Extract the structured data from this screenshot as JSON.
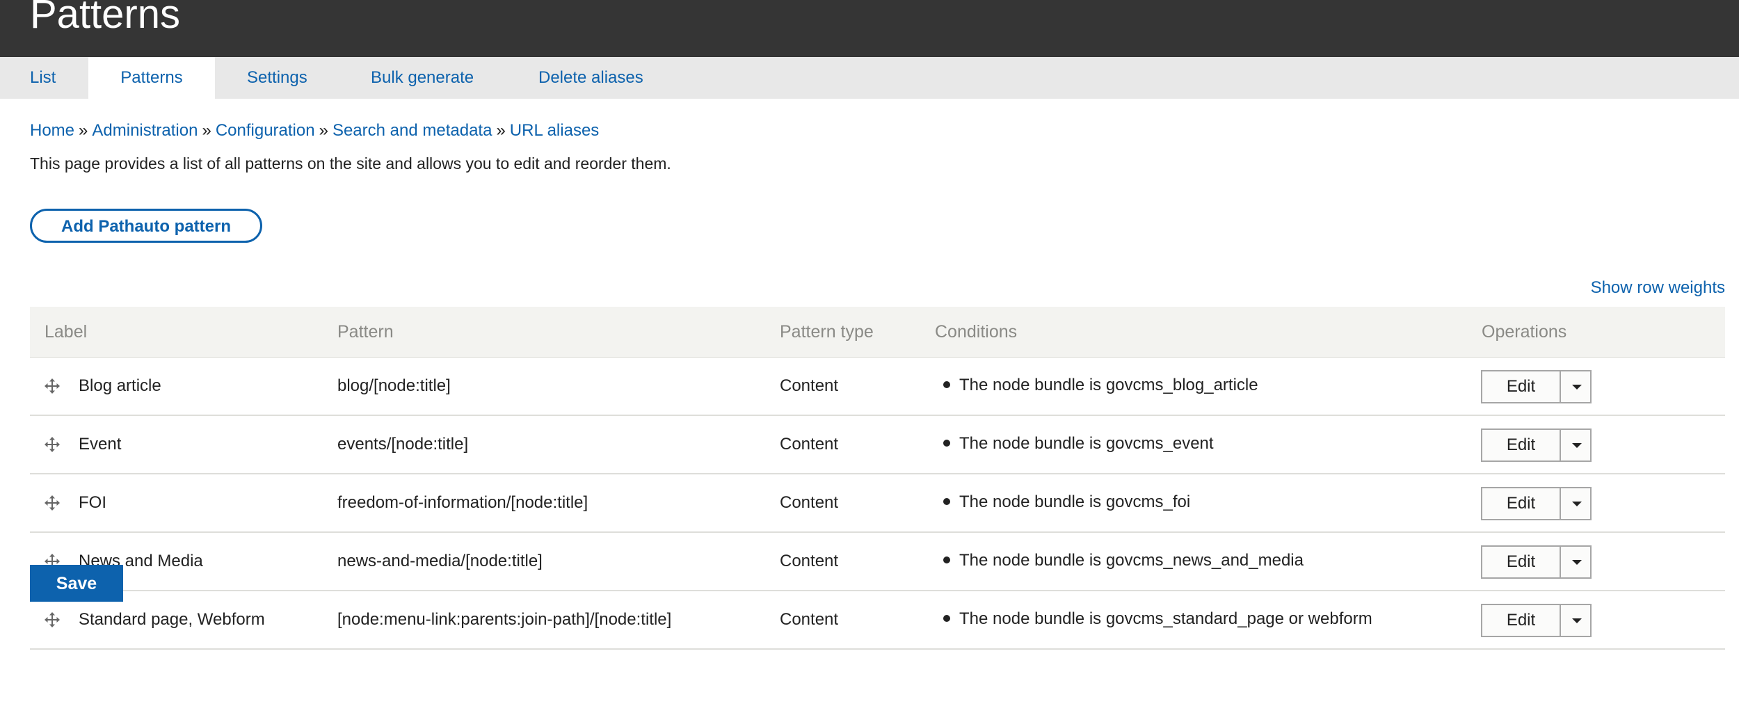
{
  "header": {
    "title": "Patterns"
  },
  "tabs": [
    {
      "label": "List",
      "active": false
    },
    {
      "label": "Patterns",
      "active": true
    },
    {
      "label": "Settings",
      "active": false
    },
    {
      "label": "Bulk generate",
      "active": false
    },
    {
      "label": "Delete aliases",
      "active": false
    }
  ],
  "breadcrumb": {
    "items": [
      "Home",
      "Administration",
      "Configuration",
      "Search and metadata",
      "URL aliases"
    ],
    "separator": "»"
  },
  "description": "This page provides a list of all patterns on the site and allows you to edit and reorder them.",
  "add_button_label": "Add Pathauto pattern",
  "show_row_weights_label": "Show row weights",
  "table": {
    "columns": [
      "Label",
      "Pattern",
      "Pattern type",
      "Conditions",
      "Operations"
    ],
    "rows": [
      {
        "label": "Blog article",
        "pattern": "blog/[node:title]",
        "type": "Content",
        "condition": "The node bundle is govcms_blog_article",
        "edit": "Edit"
      },
      {
        "label": "Event",
        "pattern": "events/[node:title]",
        "type": "Content",
        "condition": "The node bundle is govcms_event",
        "edit": "Edit"
      },
      {
        "label": "FOI",
        "pattern": "freedom-of-information/[node:title]",
        "type": "Content",
        "condition": "The node bundle is govcms_foi",
        "edit": "Edit"
      },
      {
        "label": "News and Media",
        "pattern": "news-and-media/[node:title]",
        "type": "Content",
        "condition": "The node bundle is govcms_news_and_media",
        "edit": "Edit"
      },
      {
        "label": "Standard page, Webform",
        "pattern": "[node:menu-link:parents:join-path]/[node:title]",
        "type": "Content",
        "condition": "The node bundle is govcms_standard_page or webform",
        "edit": "Edit"
      }
    ]
  },
  "save_label": "Save",
  "colors": {
    "header_bg": "#353535",
    "link": "#0d62ad",
    "tabs_bg": "#e8e8e8",
    "table_header_bg": "#f3f3f0",
    "primary_button": "#0d62ad"
  },
  "icons": {
    "drag": "move-handle-icon",
    "dropdown": "caret-down-icon"
  }
}
